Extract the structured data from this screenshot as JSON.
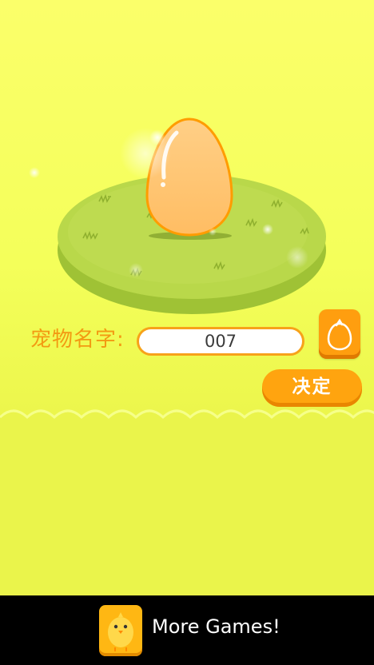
{
  "screen": {
    "pet_name_label": "宠物名字:",
    "pet_name_value": "007",
    "confirm_label": "决定"
  },
  "ad": {
    "text": "More Games!"
  },
  "icons": {
    "random": "egg-outline-icon",
    "ad": "chick-icon"
  },
  "colors": {
    "background": "#f4ff5a",
    "island": "#b9d84a",
    "egg": "#ffc66e",
    "accent": "#ff9e0f"
  }
}
